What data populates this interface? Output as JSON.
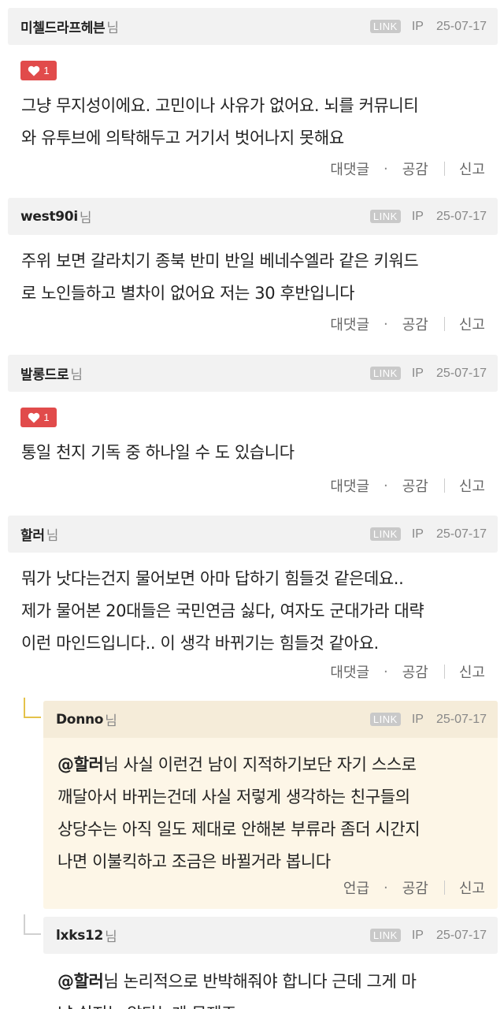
{
  "labels": {
    "nim": "님",
    "link": "LINK",
    "ip": "IP",
    "reply": "대댓글",
    "mention": "언급",
    "like": "공감",
    "report": "신고",
    "dot": "·"
  },
  "comments": [
    {
      "author": "미첼드라프헤븐",
      "date": "25-07-17",
      "likes": "1",
      "text": [
        "그냥 무지성이에요. 고민이나 사유가 없어요. 뇌를 커뮤니티",
        "와 유투브에 의탁해두고 거기서 벗어나지 못해요"
      ]
    },
    {
      "author": "west90i",
      "date": "25-07-17",
      "likes": null,
      "text": [
        "주위 보면 갈라치기 종북 반미 반일 베네수엘라 같은 키워드",
        "로 노인들하고 별차이 없어요 저는 30 후반입니다"
      ]
    },
    {
      "author": "발롱드로",
      "date": "25-07-17",
      "likes": "1",
      "text": [
        "통일 천지 기독 중 하나일 수 도 있습니다"
      ]
    },
    {
      "author": "할러",
      "date": "25-07-17",
      "likes": null,
      "text": [
        "뭐가 낫다는건지 물어보면 아마 답하기 힘들것 같은데요..",
        "제가 물어본 20대들은 국민연금 싫다, 여자도 군대가라 대략",
        "이런 마인드입니다.. 이 생각 바뀌기는 힘들것 같아요."
      ]
    }
  ],
  "replies": [
    {
      "author": "Donno",
      "date": "25-07-17",
      "mention": "@할러",
      "text": [
        "님 사실 이런건 남이 지적하기보단 자기 스스로",
        "깨달아서 바뀌는건데 사실 저렇게 생각하는 친구들의",
        "상당수는 아직 일도 제대로 안해본 부류라 좀더 시간지",
        "나면 이불킥하고 조금은 바뀔거라 봅니다"
      ]
    },
    {
      "author": "lxks12",
      "date": "25-07-17",
      "mention": "@할러",
      "text": [
        "님 논리적으로 반박해줘야 합니다 근데 그게 마",
        "냥 쉽지는 않다는게 문제죠"
      ]
    }
  ]
}
